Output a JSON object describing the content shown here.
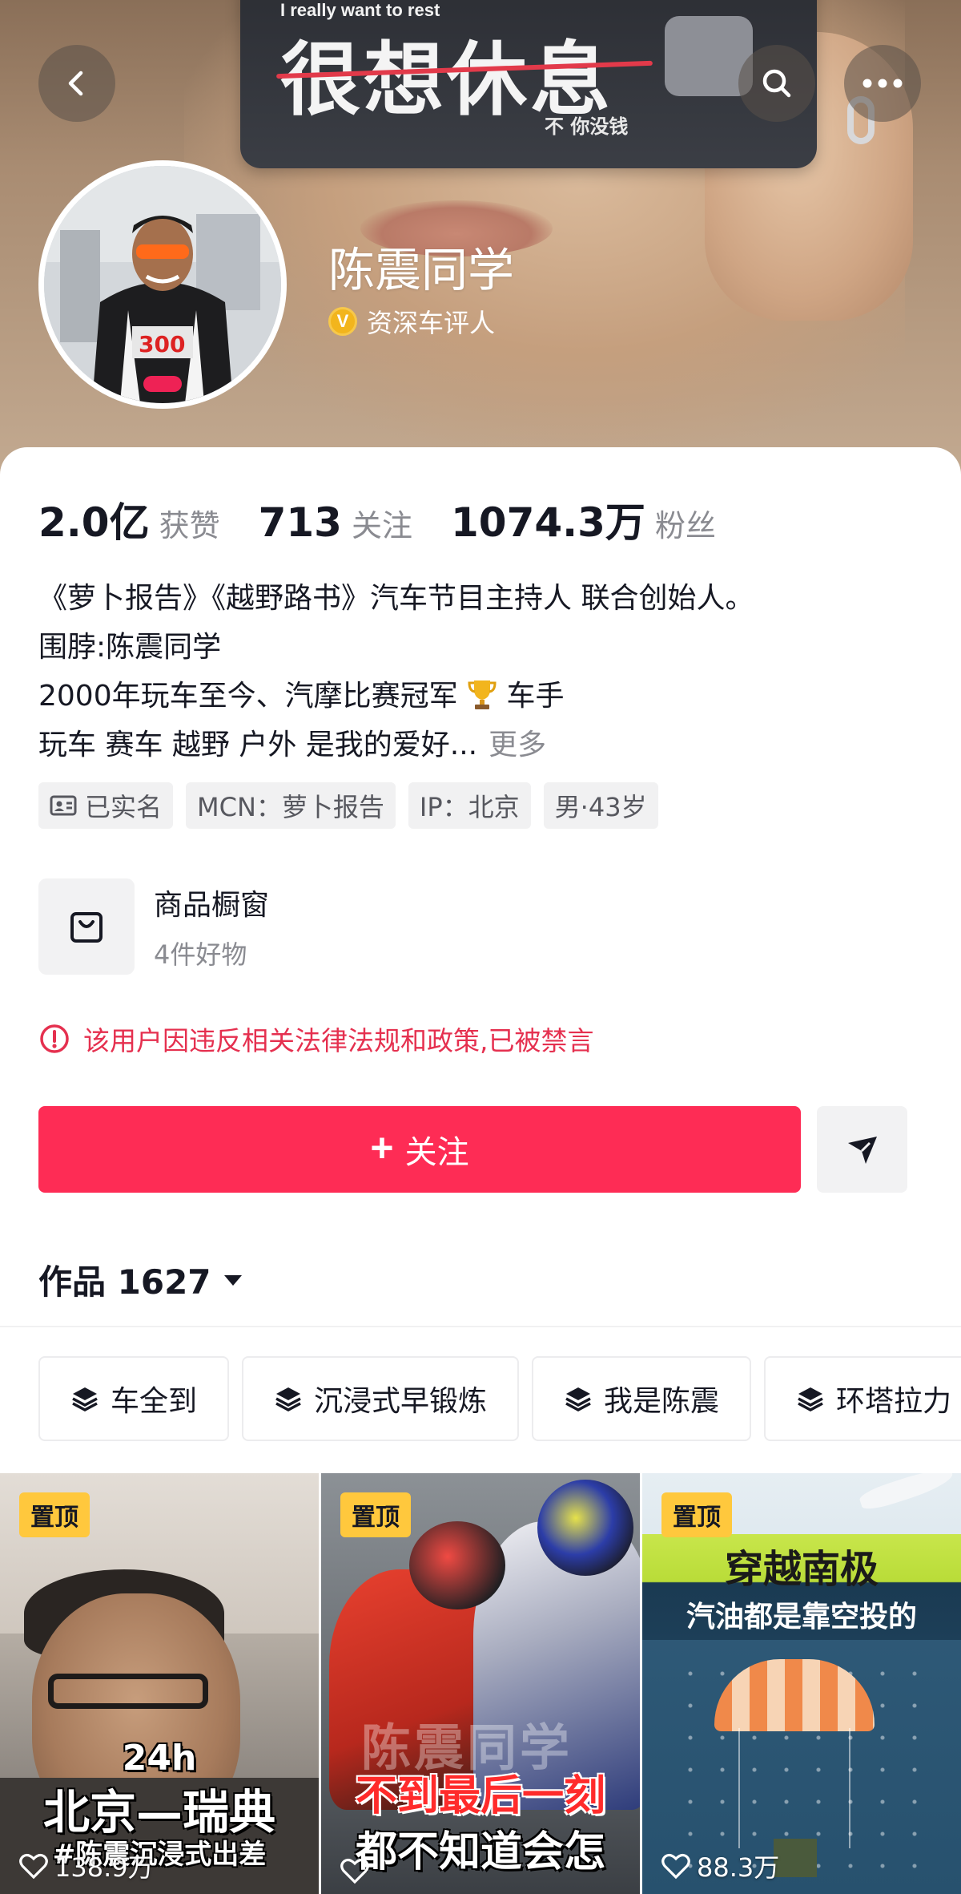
{
  "header": {
    "banner_text_en": "I really want to rest",
    "banner_text_cn": "很想休息",
    "banner_text_sub": "不 你没钱",
    "nickname": "陈震同学",
    "verify_badge": "V",
    "verify_label": "资深车评人"
  },
  "stats": [
    {
      "num": "2.0亿",
      "label": "获赞"
    },
    {
      "num": "713",
      "label": "关注"
    },
    {
      "num": "1074.3万",
      "label": "粉丝"
    }
  ],
  "bio": {
    "line1": "《萝卜报告》《越野路书》汽车节目主持人 联合创始人。",
    "line2": "围脖:陈震同学",
    "line3a": "2000年玩车至今、汽摩比赛冠军",
    "line3b": "车手",
    "line4": "玩车 赛车 越野 户外 是我的爱好...",
    "more": "更多"
  },
  "tags": [
    "已实名",
    "MCN：萝卜报告",
    "IP：北京",
    "男·43岁"
  ],
  "shop": {
    "title": "商品橱窗",
    "subtitle": "4件好物"
  },
  "ban_notice": "该用户因违反相关法律法规和政策,已被禁言",
  "follow_label": "关注",
  "works_label": "作品 1627",
  "collections": [
    "车全到",
    "沉浸式早锻炼",
    "我是陈震",
    "环塔拉力"
  ],
  "videos": [
    {
      "pin": "置顶",
      "likes": "138.9万",
      "overlay": [
        "24h",
        "北京—瑞典",
        "#陈震沉浸式出差"
      ]
    },
    {
      "pin": "置顶",
      "likes": "",
      "overlay": [
        "陈震同学",
        "不到最后一刻",
        "都不知道会怎"
      ]
    },
    {
      "pin": "置顶",
      "likes": "88.3万",
      "overlay": [
        "穿越南极",
        "汽油都是靠空投的"
      ]
    }
  ],
  "colors": {
    "accent": "#fe2c55",
    "ban_red": "#e5304f",
    "pin_yellow": "#ffc83d",
    "verify_gold": "#f2b51d"
  }
}
